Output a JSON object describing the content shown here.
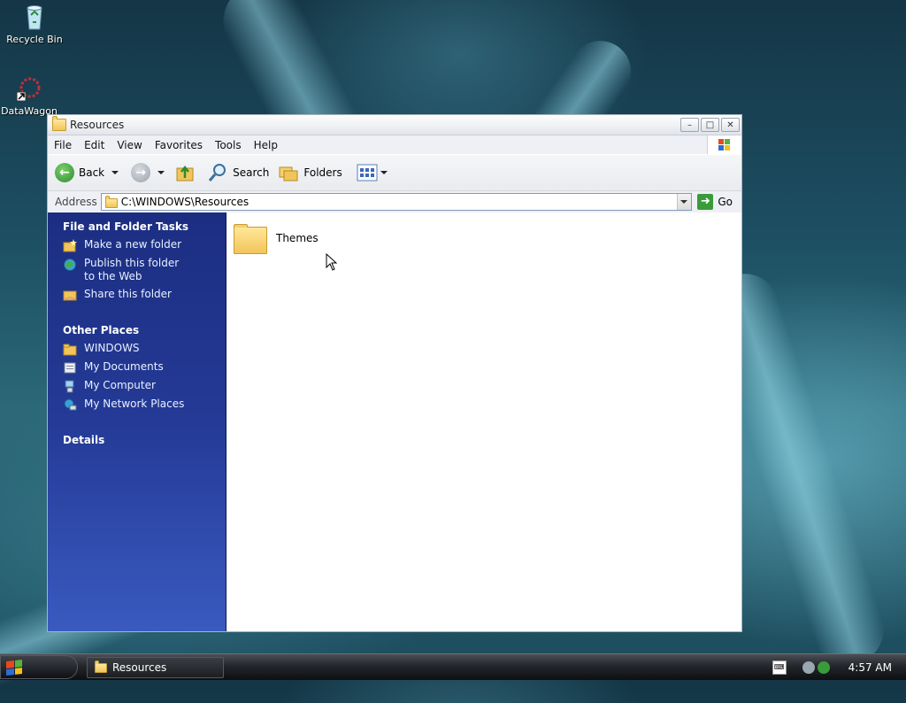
{
  "desktop": {
    "icons": [
      {
        "label": "Recycle Bin",
        "icon": "recycle-bin-icon"
      },
      {
        "label": "DataWagon",
        "icon": "shortcut-app-icon"
      }
    ]
  },
  "window": {
    "title": "Resources",
    "menu": [
      "File",
      "Edit",
      "View",
      "Favorites",
      "Tools",
      "Help"
    ],
    "toolbar": {
      "back_label": "Back",
      "search_label": "Search",
      "folders_label": "Folders"
    },
    "address": {
      "label": "Address",
      "value": "C:\\WINDOWS\\Resources",
      "go_label": "Go"
    },
    "taskpane": {
      "file_tasks_title": "File and Folder Tasks",
      "file_tasks": [
        {
          "label": "Make a new folder",
          "icon": "new-folder-icon"
        },
        {
          "label": "Publish this folder to the Web",
          "icon": "publish-web-icon"
        },
        {
          "label": "Share this folder",
          "icon": "share-folder-icon"
        }
      ],
      "other_places_title": "Other Places",
      "other_places": [
        {
          "label": "WINDOWS",
          "icon": "folder-icon"
        },
        {
          "label": "My Documents",
          "icon": "my-documents-icon"
        },
        {
          "label": "My Computer",
          "icon": "my-computer-icon"
        },
        {
          "label": "My Network Places",
          "icon": "network-places-icon"
        }
      ],
      "details_title": "Details"
    },
    "files": [
      {
        "name": "Themes",
        "type": "folder"
      }
    ]
  },
  "taskbar": {
    "items": [
      {
        "label": "Resources"
      }
    ],
    "clock": "4:57 AM"
  },
  "colors": {
    "taskpane_top": "#1c2e82",
    "taskpane_bottom": "#3a5ac0",
    "taskbar": "#1b1e22",
    "folder_yellow": "#f2c55a"
  }
}
